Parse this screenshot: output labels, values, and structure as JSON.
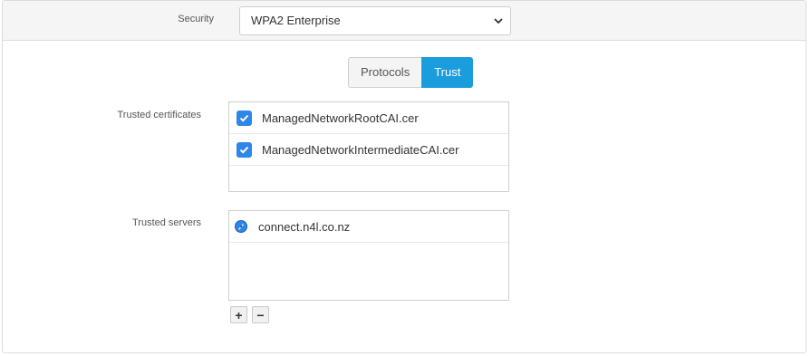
{
  "security": {
    "label": "Security",
    "selected": "WPA2 Enterprise"
  },
  "tabs": [
    {
      "label": "Protocols",
      "active": false
    },
    {
      "label": "Trust",
      "active": true
    }
  ],
  "trusted_certificates": {
    "label": "Trusted certificates",
    "items": [
      {
        "name": "ManagedNetworkRootCAI.cer",
        "checked": true
      },
      {
        "name": "ManagedNetworkIntermediateCAI.cer",
        "checked": true
      }
    ]
  },
  "trusted_servers": {
    "label": "Trusted servers",
    "items": [
      {
        "name": "connect.n4l.co.nz",
        "icon": "globe-icon"
      }
    ]
  },
  "controls": {
    "add": "+",
    "remove": "−"
  },
  "colors": {
    "accent": "#1a9ddd",
    "checkbox": "#2f86e8"
  }
}
